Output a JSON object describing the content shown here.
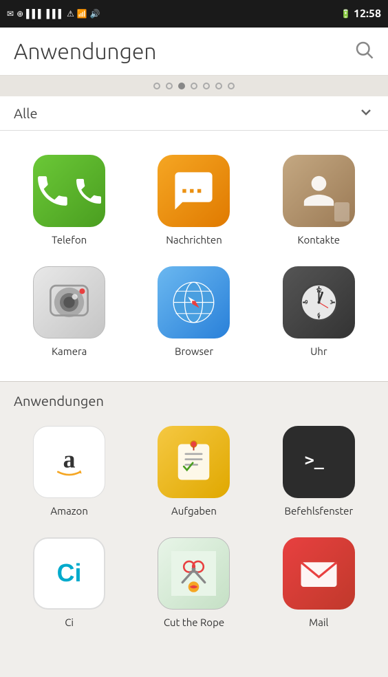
{
  "statusBar": {
    "time": "12:58",
    "icons": [
      "email",
      "gps",
      "signal1",
      "signal2",
      "warning",
      "wifi",
      "volume",
      "battery"
    ]
  },
  "header": {
    "title": "Anwendungen",
    "searchLabel": "Suchen"
  },
  "pageDots": {
    "total": 7,
    "active": 2
  },
  "categoryBar": {
    "label": "Alle",
    "dropdownHint": "Kategorie wählen"
  },
  "featuredApps": [
    {
      "id": "telefon",
      "label": "Telefon"
    },
    {
      "id": "nachrichten",
      "label": "Nachrichten"
    },
    {
      "id": "kontakte",
      "label": "Kontakte"
    },
    {
      "id": "kamera",
      "label": "Kamera"
    },
    {
      "id": "browser",
      "label": "Browser"
    },
    {
      "id": "uhr",
      "label": "Uhr"
    }
  ],
  "appsSection": {
    "title": "Anwendungen",
    "apps": [
      {
        "id": "amazon",
        "label": "Amazon"
      },
      {
        "id": "aufgaben",
        "label": "Aufgaben"
      },
      {
        "id": "befehlsfenster",
        "label": "Befehlsfenster"
      },
      {
        "id": "ci",
        "label": "Ci"
      },
      {
        "id": "cuttherope",
        "label": "Cut the Rope"
      },
      {
        "id": "mail",
        "label": "Mail"
      }
    ]
  }
}
